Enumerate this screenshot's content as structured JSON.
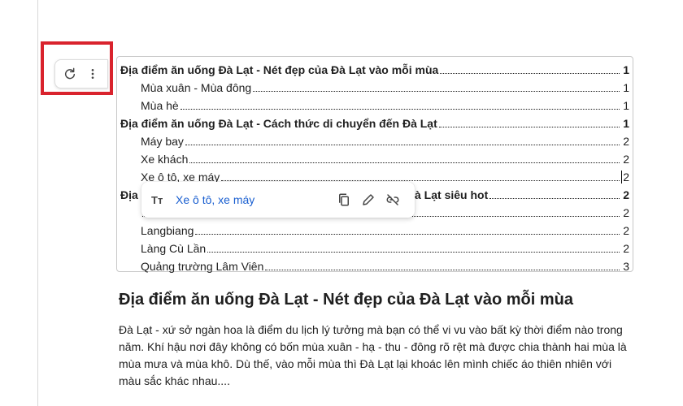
{
  "toc_tools": {
    "refresh_icon": "refresh-icon",
    "more_icon": "more-vertical-icon"
  },
  "toc": {
    "items": [
      {
        "text": "Địa điểm ăn uống Đà Lạt - Nét đẹp của Đà Lạt vào mỗi mùa",
        "page": "1",
        "level": 1
      },
      {
        "text": "Mùa xuân - Mùa đông",
        "page": "1",
        "level": 2
      },
      {
        "text": "Mùa hè",
        "page": "1",
        "level": 2
      },
      {
        "text": "Địa điểm ăn uống Đà Lạt - Cách thức di chuyển đến Đà Lạt",
        "page": "1",
        "level": 1
      },
      {
        "text": "Máy bay",
        "page": "2",
        "level": 2
      },
      {
        "text": "Xe khách",
        "page": "2",
        "level": 2
      },
      {
        "text": "Xe ô tô, xe máy",
        "page": "2",
        "level": 2
      },
      {
        "text": "Địa",
        "page": "2",
        "level": 1
      },
      {
        "text": "",
        "page": "2",
        "level": 2
      },
      {
        "text": "Langbiang",
        "page": "2",
        "level": 2
      },
      {
        "text": "Làng Cù Lần",
        "page": "2",
        "level": 2
      },
      {
        "text": "Quảng trường Lâm Viên",
        "page": "3",
        "level": 2
      }
    ],
    "hidden_row_tail": "in Đà Lạt siêu hot"
  },
  "link_popup": {
    "text_style_glyph": "Tт",
    "link_text": "Xe ô tô, xe máy",
    "copy_icon": "copy-icon",
    "edit_icon": "edit-pencil-icon",
    "unlink_icon": "unlink-icon"
  },
  "body": {
    "heading": "Địa điểm ăn uống Đà Lạt - Nét đẹp của Đà Lạt vào mỗi mùa",
    "paragraph": "Đà Lạt - xứ sở ngàn hoa là điểm du lịch lý tưởng mà bạn có thể vi vu vào bất kỳ thời điểm nào trong năm. Khí hậu nơi đây không có bốn mùa xuân - hạ - thu - đông rõ rệt mà được chia thành hai mùa là mùa mưa và mùa khô. Dù thế, vào mỗi mùa thì Đà Lạt lại khoác lên mình chiếc áo thiên nhiên với màu sắc khác nhau...."
  },
  "colors": {
    "highlight": "#d9232d",
    "link": "#1a5fd0"
  }
}
